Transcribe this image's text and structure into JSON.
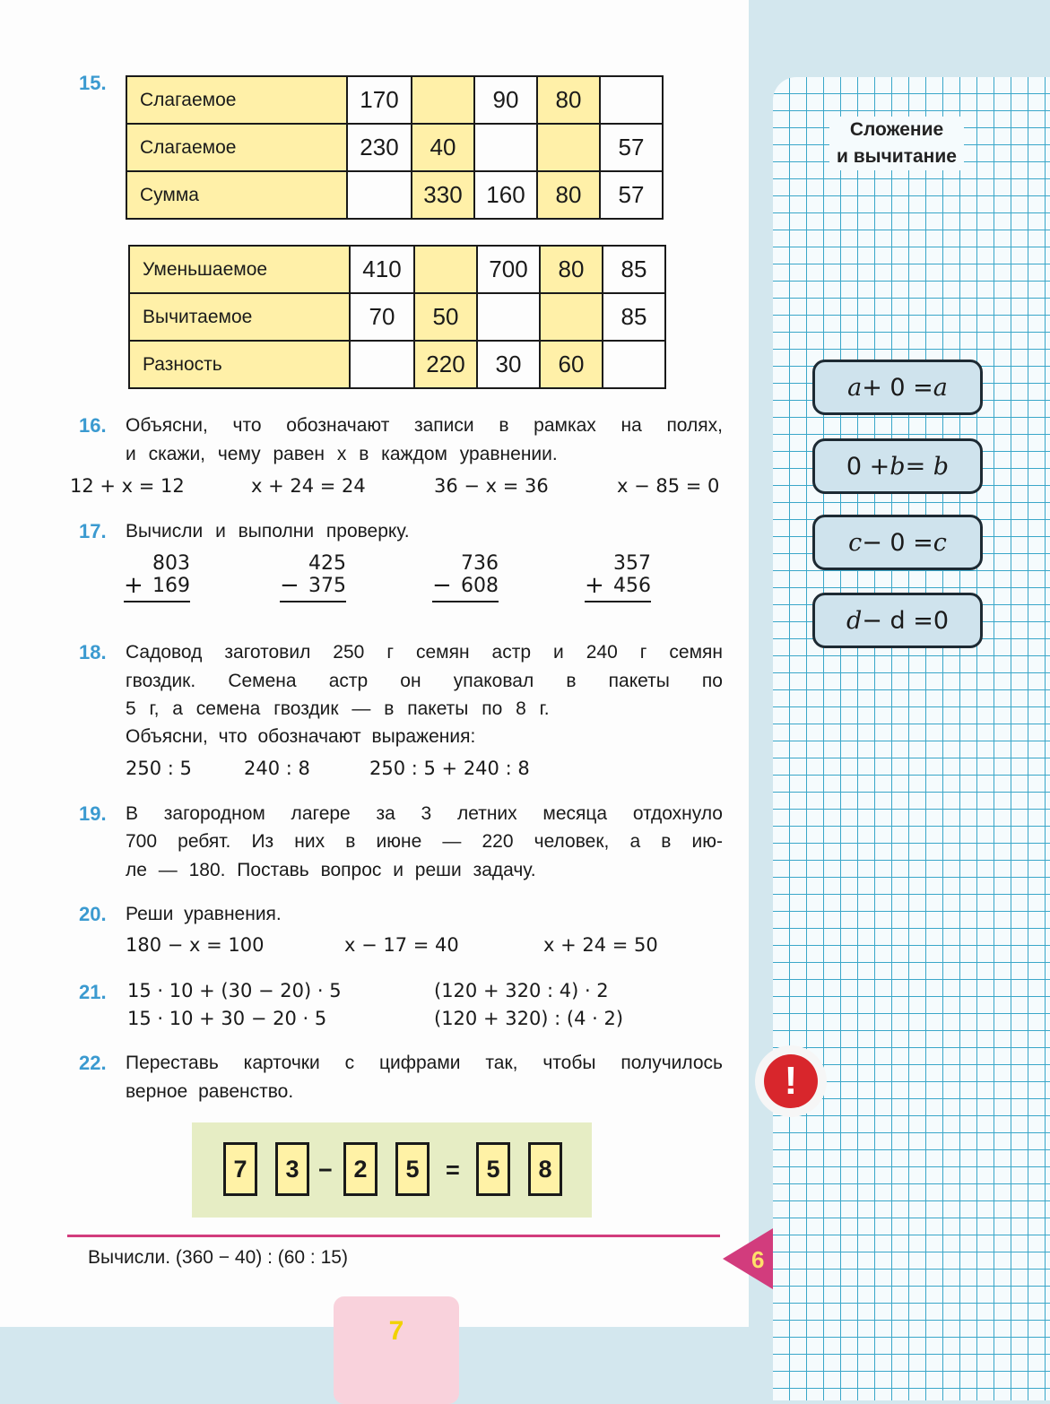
{
  "side": {
    "topic_line1": "Сложение",
    "topic_line2": "и вычитание",
    "rules": [
      {
        "a": "a",
        "op": " + 0 = ",
        "b": "a"
      },
      {
        "a": "0 + ",
        "op": "b",
        "b": " = b"
      },
      {
        "a": "c",
        "op": " − 0 = ",
        "b": "c"
      },
      {
        "a": "d",
        "op": " − d = ",
        "b": "0"
      }
    ]
  },
  "t15": {
    "num": "15.",
    "rows": [
      {
        "label": "Слагаемое",
        "cells": [
          "170",
          "",
          "90",
          "80",
          ""
        ]
      },
      {
        "label": "Слагаемое",
        "cells": [
          "230",
          "40",
          "",
          "",
          "57"
        ]
      },
      {
        "label": "Сумма",
        "cells": [
          "",
          "330",
          "160",
          "80",
          "57"
        ]
      }
    ],
    "rows2": [
      {
        "label": "Уменьшаемое",
        "cells": [
          "410",
          "",
          "700",
          "80",
          "85"
        ]
      },
      {
        "label": "Вычитаемое",
        "cells": [
          "70",
          "50",
          "",
          "",
          "85"
        ]
      },
      {
        "label": "Разность",
        "cells": [
          "",
          "220",
          "30",
          "60",
          ""
        ]
      }
    ]
  },
  "t16": {
    "num": "16.",
    "line1": "Объясни, что обозначают записи в рамках на полях,",
    "line2": "и скажи, чему равен x в каждом уравнении.",
    "eq": [
      "12 + x = 12",
      "x + 24 = 24",
      "36 − x = 36",
      "x − 85 = 0"
    ]
  },
  "t17": {
    "num": "17.",
    "text": "Вычисли и выполни проверку.",
    "cols": [
      {
        "a": "803",
        "b": "169",
        "sign": "+"
      },
      {
        "a": "425",
        "b": "375",
        "sign": "−"
      },
      {
        "a": "736",
        "b": "608",
        "sign": "−"
      },
      {
        "a": "357",
        "b": "456",
        "sign": "+"
      }
    ]
  },
  "t18": {
    "num": "18.",
    "line1": "Садовод заготовил 250 г семян астр и 240 г семян",
    "line2": "гвоздик. Семена астр он упаковал в пакеты по",
    "line3": "5 г, а семена гвоздик — в пакеты по 8 г.",
    "line4": "Объясни, что обозначают выражения:",
    "ex": [
      "250 : 5",
      "240 : 8",
      "250 : 5 + 240 : 8"
    ]
  },
  "t19": {
    "num": "19.",
    "line1": "В загородном лагере за 3 летних месяца отдохнуло",
    "line2": "700 ребят. Из них в июне — 220 человек, а в ию-",
    "line3": "ле — 180. Поставь вопрос и реши задачу."
  },
  "t20": {
    "num": "20.",
    "text": "Реши уравнения.",
    "eq": [
      "180 − x = 100",
      "x − 17 = 40",
      "x + 24 = 50"
    ]
  },
  "t21": {
    "num": "21.",
    "e1": "15 · 10 + (30 − 20) · 5",
    "e2": "(120 + 320 : 4) · 2",
    "e3": "15 · 10 + 30 − 20 · 5",
    "e4": "(120 + 320) : (4 · 2)"
  },
  "t22": {
    "num": "22.",
    "line1": "Переставь карточки с цифрами так, чтобы получилось",
    "line2": "верное равенство.",
    "tiles": [
      "7",
      "3",
      "2",
      "5",
      "5",
      "8"
    ],
    "minus": "−",
    "equals": "="
  },
  "footer": {
    "task": "Вычисли. (360 − 40) : (60 : 15)",
    "section_mark": "6",
    "page_number": "7",
    "alert_symbol": "!"
  }
}
